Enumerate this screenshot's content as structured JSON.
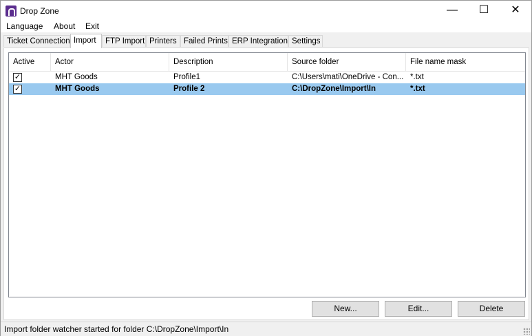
{
  "window": {
    "title": "Drop Zone",
    "minimize": "—",
    "maximize": "☐",
    "close": "✕"
  },
  "menu": [
    "Language",
    "About",
    "Exit"
  ],
  "tabs": [
    "Ticket Connection",
    "Import",
    "FTP Import",
    "Printers",
    "Failed Prints",
    "ERP Integration",
    "Settings"
  ],
  "active_tab": "Import",
  "table": {
    "columns": [
      "Active",
      "Actor",
      "Description",
      "Source folder",
      "File name mask"
    ],
    "rows": [
      {
        "active": true,
        "actor": "MHT Goods",
        "description": "Profile1",
        "source": "C:\\Users\\mati\\OneDrive - Con...",
        "mask": "*.txt",
        "selected": false
      },
      {
        "active": true,
        "actor": "MHT Goods",
        "description": "Profile 2",
        "source": "C:\\DropZone\\Import\\In",
        "mask": "*.txt",
        "selected": true
      }
    ]
  },
  "buttons": {
    "new": "New...",
    "edit": "Edit...",
    "delete": "Delete"
  },
  "status": "Import folder watcher started for folder C:\\DropZone\\Import\\In",
  "colors": {
    "selection": "#99c9ef",
    "app_icon": "#5b2d8e"
  },
  "icons": {
    "app": "drop-zone-app-icon",
    "check": "checkmark-icon"
  }
}
